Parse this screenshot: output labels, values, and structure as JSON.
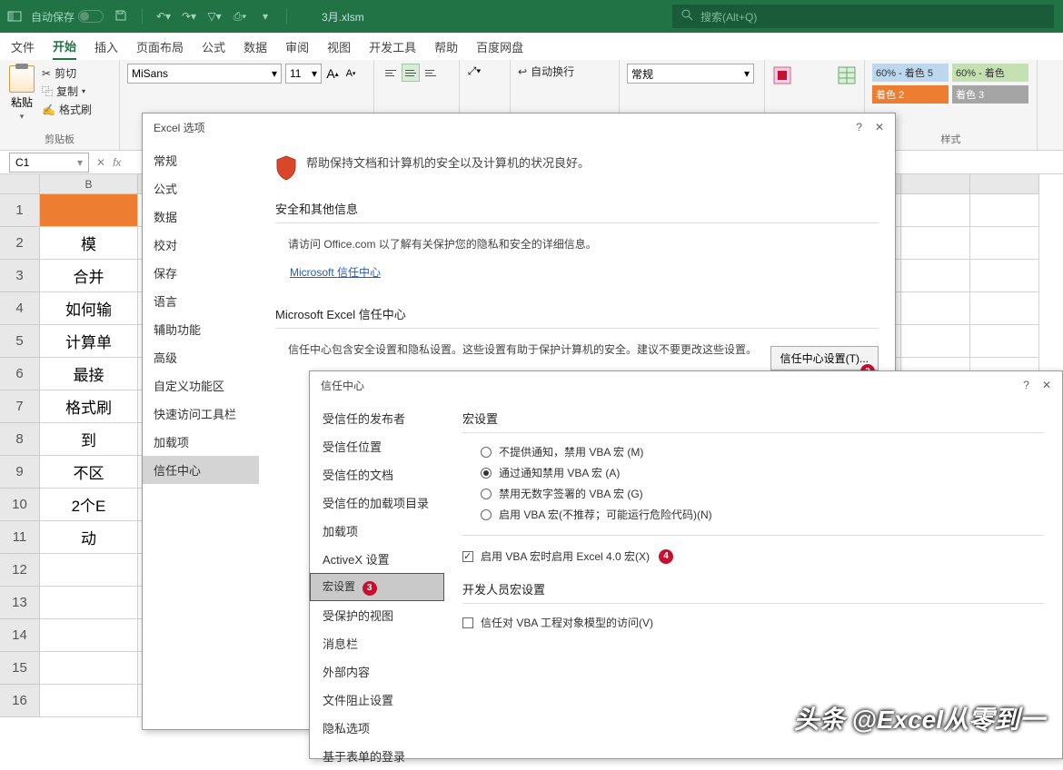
{
  "titlebar": {
    "autosave": "自动保存",
    "filename": "3月.xlsm",
    "search_placeholder": "搜索(Alt+Q)"
  },
  "tabs": [
    "文件",
    "开始",
    "插入",
    "页面布局",
    "公式",
    "数据",
    "审阅",
    "视图",
    "开发工具",
    "帮助",
    "百度网盘"
  ],
  "ribbon": {
    "paste": "粘贴",
    "cut": "剪切",
    "copy": "复制",
    "format_painter": "格式刷",
    "clipboard": "剪贴板",
    "font_name": "MiSans",
    "font_size": "11",
    "wrap": "自动换行",
    "number_format": "常规",
    "styles_label": "样式",
    "style1": "60% - 着色 5",
    "style2": "60% - 着色",
    "style3": "着色 2",
    "style4": "着色 3"
  },
  "name_box": "C1",
  "col_headers": [
    "B"
  ],
  "rows_data": [
    "",
    "模",
    "合并",
    "如何输",
    "计算单",
    "最接",
    "格式刷",
    "到",
    "不区",
    "2个E",
    "动"
  ],
  "options_dialog": {
    "title": "Excel 选项",
    "side": [
      "常规",
      "公式",
      "数据",
      "校对",
      "保存",
      "语言",
      "辅助功能",
      "高级",
      "自定义功能区",
      "快速访问工具栏",
      "加载项",
      "信任中心"
    ],
    "shield_text": "帮助保持文档和计算机的安全以及计算机的状况良好。",
    "sec1": "安全和其他信息",
    "sec1_desc": "请访问 Office.com 以了解有关保护您的隐私和安全的详细信息。",
    "link": "Microsoft 信任中心",
    "sec2": "Microsoft Excel 信任中心",
    "sec2_desc": "信任中心包含安全设置和隐私设置。这些设置有助于保护计算机的安全。建议不要更改这些设置。",
    "button": "信任中心设置(T)..."
  },
  "trust_dialog": {
    "title": "信任中心",
    "side": [
      "受信任的发布者",
      "受信任位置",
      "受信任的文档",
      "受信任的加载项目录",
      "加载项",
      "ActiveX 设置",
      "宏设置",
      "受保护的视图",
      "消息栏",
      "外部内容",
      "文件阻止设置",
      "隐私选项",
      "基于表单的登录"
    ],
    "group1": "宏设置",
    "radio1": "不提供通知，禁用 VBA 宏 (M)",
    "radio2": "通过通知禁用 VBA 宏 (A)",
    "radio3": "禁用无数字签署的 VBA 宏 (G)",
    "radio4": "启用 VBA 宏(不推荐；可能运行危险代码)(N)",
    "check1": "启用 VBA 宏时启用 Excel 4.0 宏(X)",
    "group2": "开发人员宏设置",
    "check2": "信任对 VBA 工程对象模型的访问(V)"
  },
  "watermark": "头条 @Excel从零到一"
}
